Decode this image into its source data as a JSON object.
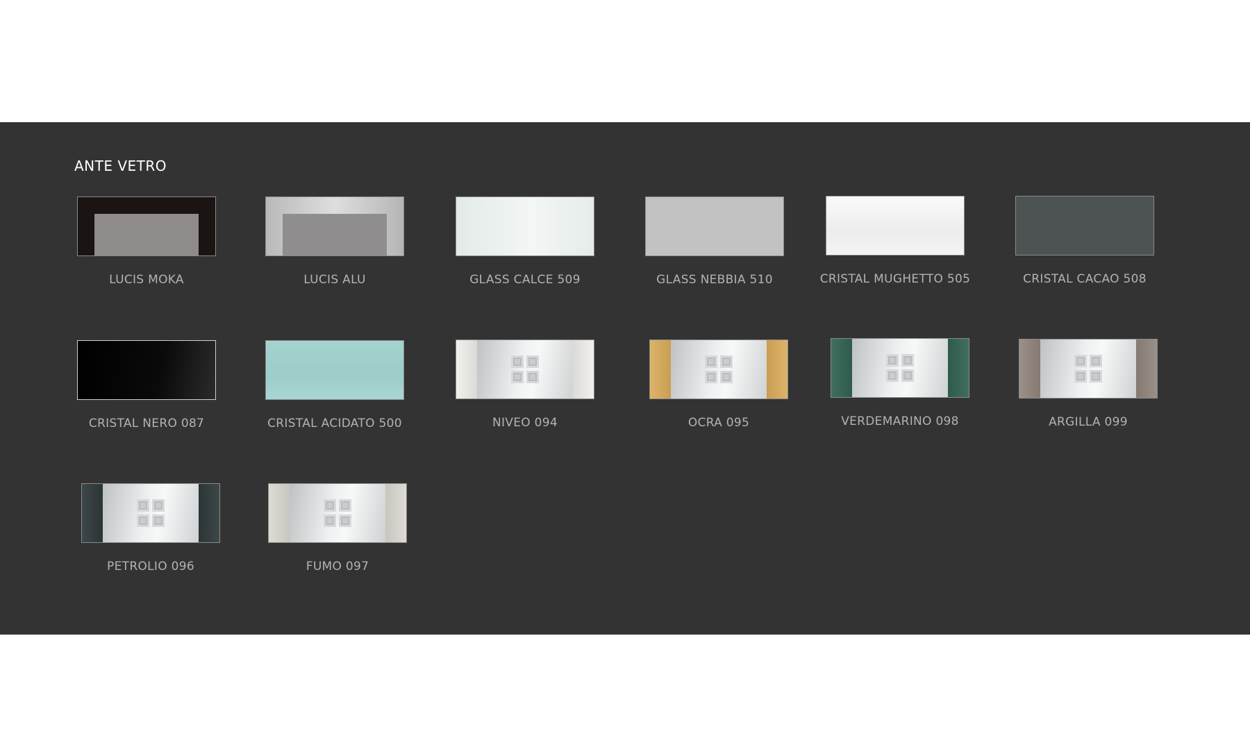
{
  "section": {
    "title": "ANTE VETRO"
  },
  "swatches": [
    {
      "label": "LUCIS MOKA",
      "style": "frame",
      "frame_color": "#1a1412",
      "inner_color": "#8e8b89"
    },
    {
      "label": "LUCIS ALU",
      "style": "frame",
      "frame_color": "#c9c9c9",
      "inner_color": "#8f8d8d"
    },
    {
      "label": "GLASS CALCE 509",
      "style": "plain",
      "color": "#e8efec"
    },
    {
      "label": "GLASS NEBBIA 510",
      "style": "plain",
      "color": "#c2c2c2"
    },
    {
      "label": "CRISTAL MUGHETTO 505",
      "style": "plain",
      "color": "#f2f2f2"
    },
    {
      "label": "CRISTAL CACAO 508",
      "style": "plain",
      "color": "#4d5352"
    },
    {
      "label": "CRISTAL NERO 087",
      "style": "plain",
      "color": "#0a0a0a"
    },
    {
      "label": "CRISTAL ACIDATO 500",
      "style": "plain",
      "color": "#9fd0cc"
    },
    {
      "label": "NIVEO 094",
      "style": "deco",
      "bar_color": "#ecebe8"
    },
    {
      "label": "OCRA 095",
      "style": "deco",
      "bar_color": "#d7b26a"
    },
    {
      "label": "VERDEMARINO 098",
      "style": "deco",
      "bar_color": "#3c6b5c"
    },
    {
      "label": "ARGILLA 099",
      "style": "deco",
      "bar_color": "#958a82"
    },
    {
      "label": "PETROLIO 096",
      "style": "deco",
      "bar_color": "#3b4446"
    },
    {
      "label": "FUMO 097",
      "style": "deco",
      "bar_color": "#d9d6d0"
    }
  ]
}
